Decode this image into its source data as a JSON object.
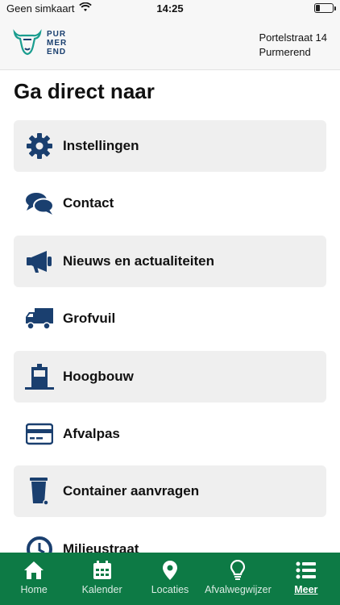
{
  "status_bar": {
    "carrier": "Geen simkaart",
    "time": "14:25",
    "battery_level": 0.2
  },
  "header": {
    "logo_lines": [
      "PUR",
      "MER",
      "END"
    ],
    "address_line1": "Portelstraat 14",
    "address_line2": "Purmerend"
  },
  "page_title": "Ga direct naar",
  "menu_items": [
    {
      "label": "Instellingen",
      "icon": "gear-icon"
    },
    {
      "label": "Contact",
      "icon": "chat-icon"
    },
    {
      "label": "Nieuws en actualiteiten",
      "icon": "megaphone-icon"
    },
    {
      "label": "Grofvuil",
      "icon": "truck-icon"
    },
    {
      "label": "Hoogbouw",
      "icon": "building-icon"
    },
    {
      "label": "Afvalpas",
      "icon": "card-icon"
    },
    {
      "label": "Container aanvragen",
      "icon": "bin-icon"
    },
    {
      "label": "Milieustraat",
      "icon": "clock-icon"
    }
  ],
  "bottom_nav": [
    {
      "label": "Home",
      "icon": "home-icon",
      "active": false
    },
    {
      "label": "Kalender",
      "icon": "calendar-icon",
      "active": false
    },
    {
      "label": "Locaties",
      "icon": "location-pin-icon",
      "active": false
    },
    {
      "label": "Afvalwegwijzer",
      "icon": "lightbulb-icon",
      "active": false
    },
    {
      "label": "Meer",
      "icon": "list-icon",
      "active": true
    }
  ],
  "colors": {
    "nav_background": "#0d7a45",
    "icon_primary": "#1a3f6f",
    "row_shade": "#efefef"
  }
}
